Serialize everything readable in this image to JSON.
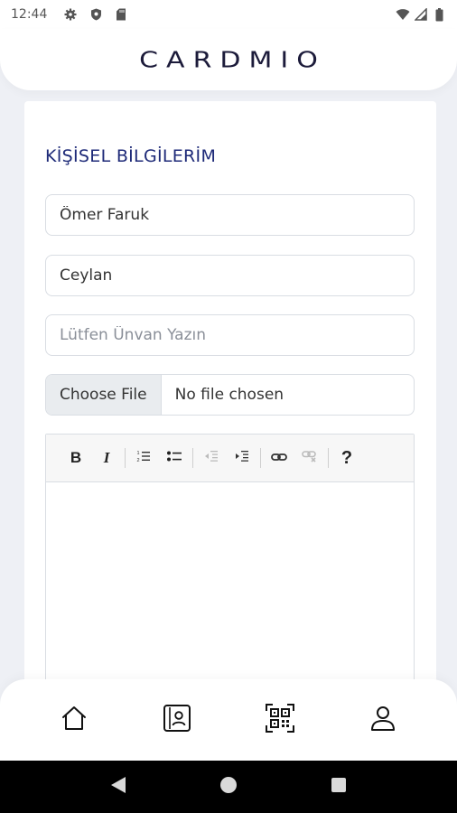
{
  "status_bar": {
    "time": "12:44",
    "left_icons": [
      "gear-icon",
      "shield-icon",
      "sd-card-icon"
    ],
    "right_icons": [
      "wifi-icon",
      "cell-signal-icon",
      "battery-icon"
    ]
  },
  "header": {
    "logo_text": "CARDMIO"
  },
  "form": {
    "section_title": "KİŞİSEL BİLGİLERİM",
    "first_name": {
      "value": "Ömer Faruk",
      "placeholder": ""
    },
    "last_name": {
      "value": "Ceylan",
      "placeholder": ""
    },
    "title_field": {
      "value": "",
      "placeholder": "Lütfen Ünvan Yazın"
    },
    "file_input": {
      "button_label": "Choose File",
      "status": "No file chosen"
    },
    "editor": {
      "toolbar": {
        "bold": "B",
        "italic": "I",
        "help": "?"
      },
      "content": ""
    }
  },
  "bottom_nav": {
    "items": [
      "home-icon",
      "contact-card-icon",
      "qr-code-icon",
      "profile-icon"
    ]
  },
  "system_nav": {
    "items": [
      "back-icon",
      "home-circle-icon",
      "recents-icon"
    ]
  },
  "colors": {
    "accent": "#1e2a78",
    "logo": "#1c1b3a",
    "background": "#eef0f5"
  }
}
